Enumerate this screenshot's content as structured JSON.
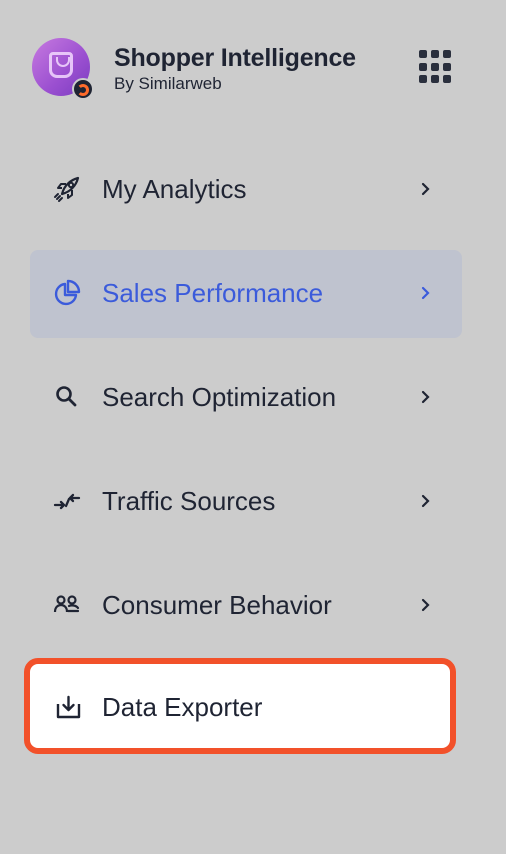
{
  "app": {
    "title": "Shopper Intelligence",
    "subtitle": "By Similarweb",
    "logo_icon": "shopping-bag-icon",
    "apps_icon": "apps-grid-icon"
  },
  "nav": {
    "items": [
      {
        "label": "My Analytics",
        "icon": "rocket-icon",
        "active": false,
        "has_chevron": true
      },
      {
        "label": "Sales Performance",
        "icon": "pie-chart-icon",
        "active": true,
        "has_chevron": true
      },
      {
        "label": "Search Optimization",
        "icon": "search-icon",
        "active": false,
        "has_chevron": true
      },
      {
        "label": "Traffic Sources",
        "icon": "arrows-in-icon",
        "active": false,
        "has_chevron": true
      },
      {
        "label": "Consumer Behavior",
        "icon": "users-icon",
        "active": false,
        "has_chevron": true
      },
      {
        "label": "Data Exporter",
        "icon": "download-icon",
        "active": false,
        "has_chevron": false,
        "highlighted": true
      }
    ]
  },
  "colors": {
    "background": "#cccccc",
    "active_bg": "#bfc3cf",
    "active_text": "#3b5bdb",
    "highlight_border": "#f2512a"
  }
}
